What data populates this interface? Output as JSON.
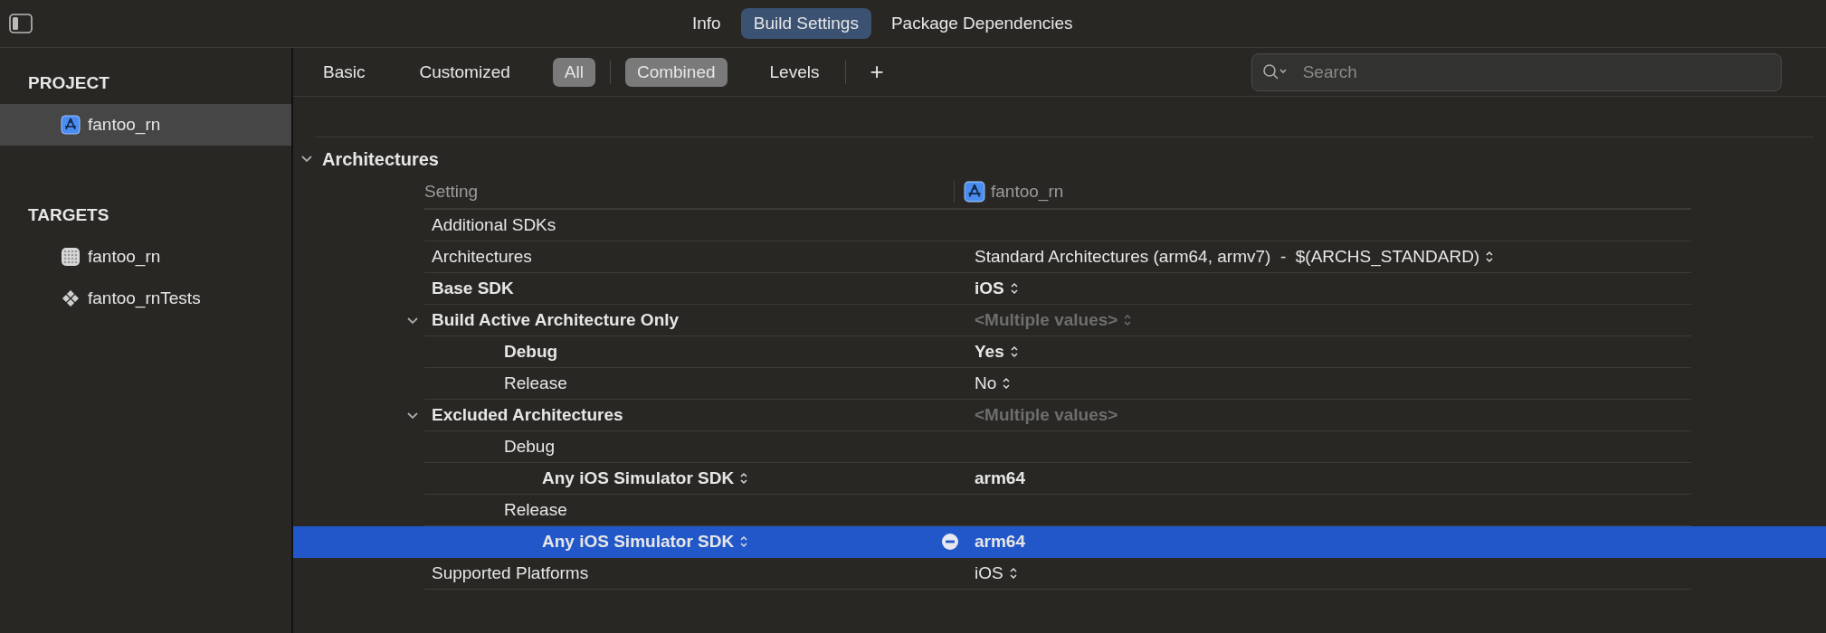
{
  "tabs": [
    {
      "label": "Info",
      "selected": false
    },
    {
      "label": "Build Settings",
      "selected": true
    },
    {
      "label": "Package Dependencies",
      "selected": false
    }
  ],
  "sidebar": {
    "sections": [
      {
        "title": "PROJECT",
        "items": [
          {
            "label": "fantoo_rn",
            "kind": "project",
            "selected": true
          }
        ]
      },
      {
        "title": "TARGETS",
        "items": [
          {
            "label": "fantoo_rn",
            "kind": "app",
            "selected": false
          },
          {
            "label": "fantoo_rnTests",
            "kind": "tests",
            "selected": false
          }
        ]
      }
    ]
  },
  "filter_bar": {
    "scope": [
      {
        "label": "Basic",
        "selected": false
      },
      {
        "label": "Customized",
        "selected": false
      },
      {
        "label": "All",
        "selected": true
      }
    ],
    "view": [
      {
        "label": "Combined",
        "selected": true
      },
      {
        "label": "Levels",
        "selected": false
      }
    ],
    "add_button": "+",
    "search": {
      "placeholder": "Search"
    }
  },
  "section": {
    "title": "Architectures",
    "expanded": true,
    "columns": {
      "setting": "Setting",
      "target": "fantoo_rn"
    },
    "rows": [
      {
        "label": "Additional SDKs",
        "bold": false,
        "popup": false,
        "selected": false
      },
      {
        "label": "Architectures",
        "bold": false,
        "popup": false,
        "selected": false,
        "value": {
          "text": "Standard Architectures (arm64, armv7)  -  $(ARCHS_STANDARD)",
          "bold": false,
          "dimmed": false,
          "popup": true
        }
      },
      {
        "label": "Base SDK",
        "bold": true,
        "popup": false,
        "selected": false,
        "value": {
          "text": "iOS",
          "bold": true,
          "dimmed": false,
          "popup": true
        }
      },
      {
        "label": "Build Active Architecture Only",
        "bold": true,
        "popup": false,
        "selected": false,
        "expanded": true,
        "value": {
          "text": "<Multiple values>",
          "bold": true,
          "dimmed": true,
          "popup": true
        },
        "children": [
          {
            "label": "Debug",
            "bold": true,
            "popup": false,
            "selected": false,
            "value": {
              "text": "Yes",
              "bold": true,
              "dimmed": false,
              "popup": true
            }
          },
          {
            "label": "Release",
            "bold": false,
            "popup": false,
            "selected": false,
            "value": {
              "text": "No",
              "bold": false,
              "dimmed": false,
              "popup": true
            }
          }
        ]
      },
      {
        "label": "Excluded Architectures",
        "bold": true,
        "popup": false,
        "selected": false,
        "expanded": true,
        "value": {
          "text": "<Multiple values>",
          "bold": true,
          "dimmed": true,
          "popup": false
        },
        "children": [
          {
            "label": "Debug",
            "bold": false,
            "popup": false,
            "selected": false,
            "children": [
              {
                "label": "Any iOS Simulator SDK",
                "bold": true,
                "popup": true,
                "selected": false,
                "value": {
                  "text": "arm64",
                  "bold": true,
                  "dimmed": false,
                  "popup": false
                }
              }
            ]
          },
          {
            "label": "Release",
            "bold": false,
            "popup": false,
            "selected": false,
            "children": [
              {
                "label": "Any iOS Simulator SDK",
                "bold": true,
                "popup": true,
                "selected": true,
                "value": {
                  "text": "arm64",
                  "bold": true,
                  "dimmed": false,
                  "popup": false
                }
              }
            ]
          }
        ]
      },
      {
        "label": "Supported Platforms",
        "bold": false,
        "popup": false,
        "selected": false,
        "value": {
          "text": "iOS",
          "bold": false,
          "dimmed": false,
          "popup": true
        }
      }
    ]
  }
}
